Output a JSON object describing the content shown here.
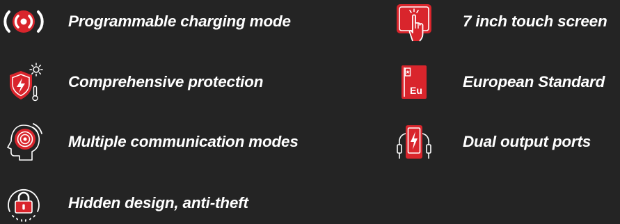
{
  "colors": {
    "background": "#242424",
    "accent": "#d9252c",
    "text": "#ffffff"
  },
  "features": [
    {
      "label": "Programmable charging mode",
      "icon": "broadcast-signal-icon"
    },
    {
      "label": "Comprehensive protection",
      "icon": "shield-lightning-icon"
    },
    {
      "label": "Multiple communication modes",
      "icon": "head-signal-icon"
    },
    {
      "label": "Hidden design, anti-theft",
      "icon": "padlock-icon"
    },
    {
      "label": "7 inch touch screen",
      "icon": "touch-screen-icon"
    },
    {
      "label": "European Standard",
      "icon": "european-standard-book-icon",
      "badge": "Eu"
    },
    {
      "label": "Dual output ports",
      "icon": "dual-port-charger-icon"
    }
  ]
}
